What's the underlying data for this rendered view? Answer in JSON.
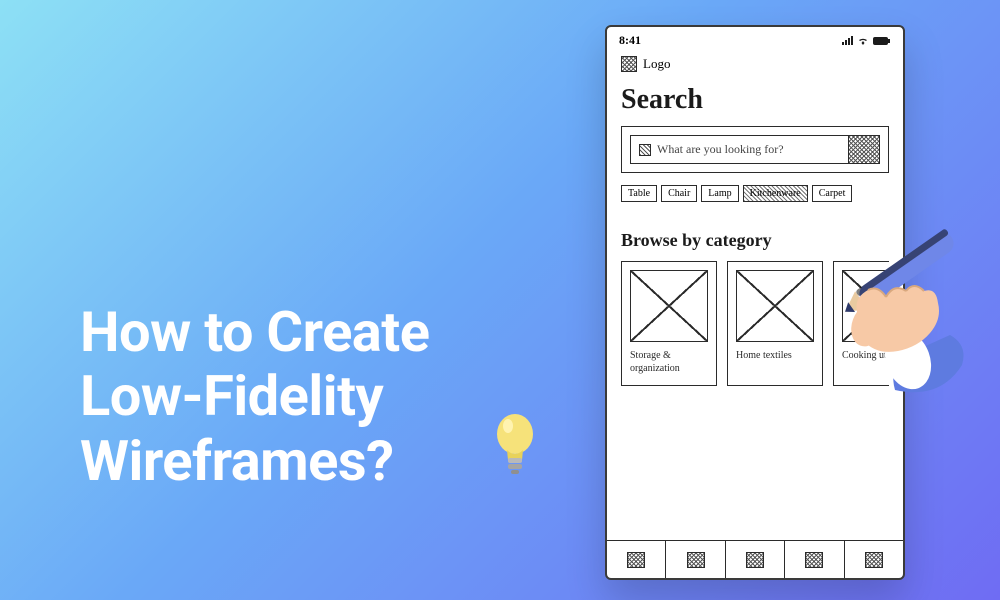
{
  "hero": {
    "line1": "How to Create",
    "line2": "Low-Fidelity",
    "line3": "Wireframes?"
  },
  "phone": {
    "status_time": "8:41",
    "logo_text": "Logo",
    "search_heading": "Search",
    "search_placeholder": "What are you looking for?",
    "chips": [
      "Table",
      "Chair",
      "Lamp",
      "Kitchenware",
      "Carpet"
    ],
    "chip_selected_index": 3,
    "browse_heading": "Browse by category",
    "categories": [
      {
        "label": "Storage & organization"
      },
      {
        "label": "Home textiles"
      },
      {
        "label": "Cooking utensils"
      }
    ],
    "tabs": [
      "home",
      "search",
      "profile",
      "wishlist",
      "cart"
    ]
  },
  "colors": {
    "pencil_body": "#6f87e8",
    "pencil_tip": "#2e3a6b",
    "skin": "#f7c9a6",
    "cuff": "#5e7be0",
    "bulb_glass": "#f6e27a",
    "bulb_base": "#b9b9b9"
  }
}
